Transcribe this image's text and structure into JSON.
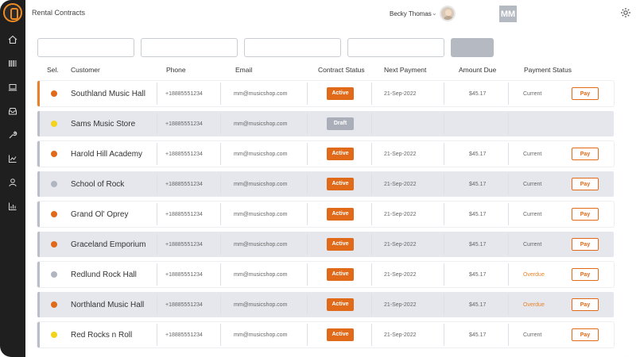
{
  "header": {
    "title": "Rental Contracts",
    "user_name": "Becky Thomas",
    "user_caret": "⌄",
    "org_badge": "MM"
  },
  "sidebar": {
    "items": [
      {
        "icon": "home-icon"
      },
      {
        "icon": "barcode-icon"
      },
      {
        "icon": "laptop-icon"
      },
      {
        "icon": "inbox-icon"
      },
      {
        "icon": "wrench-icon"
      },
      {
        "icon": "trend-chart-icon"
      },
      {
        "icon": "user-icon"
      },
      {
        "icon": "bar-chart-icon"
      }
    ]
  },
  "filters": {
    "inputs": [
      "",
      "",
      "",
      ""
    ],
    "button_label": ""
  },
  "table": {
    "columns": [
      "Sel.",
      "Customer",
      "Phone",
      "Email",
      "Contract Status",
      "Next Payment",
      "Amount Due",
      "Payment Status"
    ],
    "rows": [
      {
        "dot_color": "#e06a1a",
        "customer": "Southland Music Hall",
        "phone": "+18885551234",
        "email": "mm@musicshop.com",
        "status": "Active",
        "next_payment": "21-Sep-2022",
        "amount": "$45.17",
        "payment_status": "Current",
        "pay": "Pay"
      },
      {
        "dot_color": "#f2d51b",
        "customer": "Sams Music Store",
        "phone": "+18885551234",
        "email": "mm@musicshop.com",
        "status": "Draft",
        "next_payment": "",
        "amount": "",
        "payment_status": "",
        "pay": ""
      },
      {
        "dot_color": "#e06a1a",
        "customer": "Harold Hill Academy",
        "phone": "+18885551234",
        "email": "mm@musicshop.com",
        "status": "Active",
        "next_payment": "21-Sep-2022",
        "amount": "$45.17",
        "payment_status": "Current",
        "pay": "Pay"
      },
      {
        "dot_color": "#b0b5bf",
        "customer": "School of Rock",
        "phone": "+18885551234",
        "email": "mm@musicshop.com",
        "status": "Active",
        "next_payment": "21-Sep-2022",
        "amount": "$45.17",
        "payment_status": "Current",
        "pay": "Pay"
      },
      {
        "dot_color": "#e06a1a",
        "customer": "Grand Ol' Oprey",
        "phone": "+18885551234",
        "email": "mm@musicshop.com",
        "status": "Active",
        "next_payment": "21-Sep-2022",
        "amount": "$45.17",
        "payment_status": "Current",
        "pay": "Pay"
      },
      {
        "dot_color": "#e06a1a",
        "customer": "Graceland Emporium",
        "phone": "+18885551234",
        "email": "mm@musicshop.com",
        "status": "Active",
        "next_payment": "21-Sep-2022",
        "amount": "$45.17",
        "payment_status": "Current",
        "pay": "Pay"
      },
      {
        "dot_color": "#b0b5bf",
        "customer": "Redlund Rock Hall",
        "phone": "+18885551234",
        "email": "mm@musicshop.com",
        "status": "Active",
        "next_payment": "21-Sep-2022",
        "amount": "$45.17",
        "payment_status": "Overdue",
        "pay": "Pay"
      },
      {
        "dot_color": "#e06a1a",
        "customer": "Northland Music Hall",
        "phone": "+18885551234",
        "email": "mm@musicshop.com",
        "status": "Active",
        "next_payment": "21-Sep-2022",
        "amount": "$45.17",
        "payment_status": "Overdue",
        "pay": "Pay"
      },
      {
        "dot_color": "#f2d51b",
        "customer": "Red Rocks n Roll",
        "phone": "+18885551234",
        "email": "mm@musicshop.com",
        "status": "Active",
        "next_payment": "21-Sep-2022",
        "amount": "$45.17",
        "payment_status": "Current",
        "pay": "Pay"
      }
    ]
  },
  "colors": {
    "accent": "#e06a1a",
    "sidebar": "#1f1f1f",
    "overdue": "#e8822a",
    "draft": "#a9aeb8"
  }
}
